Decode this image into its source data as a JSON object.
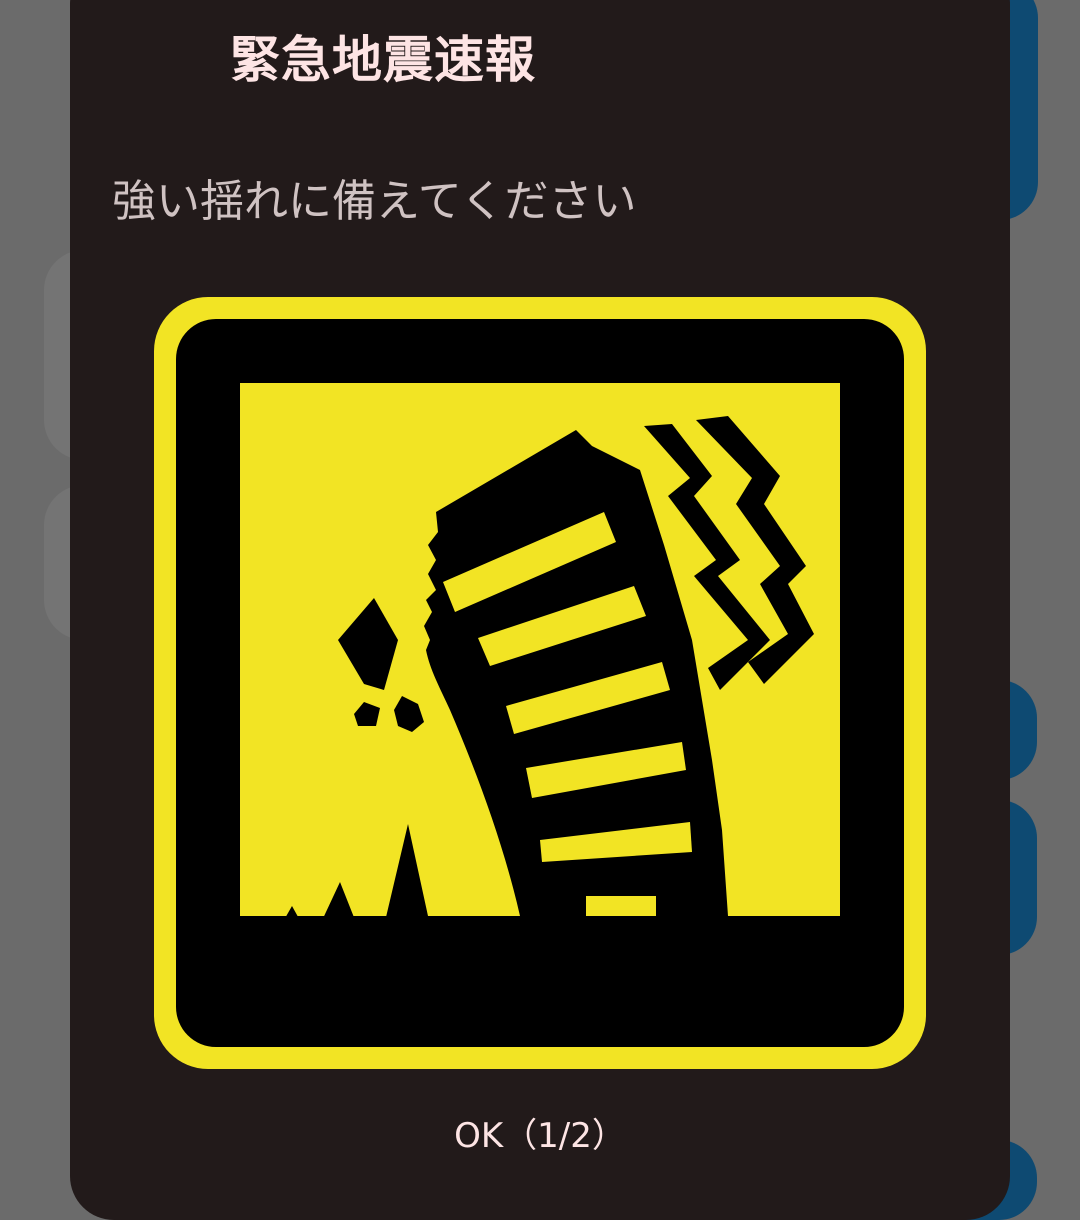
{
  "dialog": {
    "title": "緊急地震速報",
    "message": "強い揺れに備えてください",
    "ok_button_label": "OK（1/2）",
    "icon": "earthquake-collapsing-building-icon"
  },
  "colors": {
    "dialog_background": "#221a1a",
    "title_text": "#fde4e4",
    "message_text": "#cfc2c2",
    "hazard_yellow": "#f2e424",
    "hazard_black": "#000000",
    "backdrop": "#6b6b6b",
    "background_card": "#0e4a72"
  }
}
